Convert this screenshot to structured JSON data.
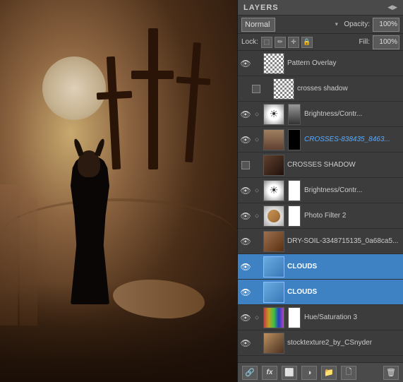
{
  "panel": {
    "title": "LAYERS",
    "collapse_label": "◀▶"
  },
  "blend": {
    "mode": "Normal",
    "opacity_label": "Opacity:",
    "opacity_value": "100%",
    "fill_label": "Fill:",
    "fill_value": "100%"
  },
  "lock": {
    "label": "Lock:"
  },
  "layers": [
    {
      "id": "pattern-overlay",
      "name": "Pattern Overlay",
      "visible": true,
      "selected": false,
      "has_eye": true,
      "has_link": false,
      "has_check": false,
      "thumb_type": "checker",
      "is_adjustment": false,
      "indent": false
    },
    {
      "id": "crosses-shadow-text",
      "name": "crosses shadow",
      "visible": false,
      "selected": false,
      "has_eye": false,
      "has_link": false,
      "has_check": true,
      "thumb_type": "checker",
      "is_adjustment": false,
      "indent": true
    },
    {
      "id": "brightness-contr-1",
      "name": "Brightness/Contr...",
      "visible": true,
      "selected": false,
      "has_eye": true,
      "has_link": true,
      "has_check": false,
      "thumb_type": "bright",
      "is_adjustment": true
    },
    {
      "id": "crosses-838435",
      "name": "CROSSES-838435_8463...",
      "visible": true,
      "selected": false,
      "has_eye": true,
      "has_link": true,
      "has_check": false,
      "thumb_type": "crosses",
      "is_adjustment": false
    },
    {
      "id": "crosses-shadow",
      "name": "CROSSES SHADOW",
      "visible": false,
      "selected": false,
      "has_eye": false,
      "has_link": false,
      "has_check": true,
      "thumb_type": "dark",
      "is_adjustment": false
    },
    {
      "id": "brightness-contr-2",
      "name": "Brightness/Contr...",
      "visible": true,
      "selected": false,
      "has_eye": true,
      "has_link": true,
      "has_check": false,
      "thumb_type": "bright",
      "is_adjustment": true
    },
    {
      "id": "photo-filter-2",
      "name": "Photo Filter 2",
      "visible": true,
      "selected": false,
      "has_eye": true,
      "has_link": true,
      "has_check": false,
      "thumb_type": "photo_filter",
      "is_adjustment": true
    },
    {
      "id": "dry-soil",
      "name": "DRY-SOIL-3348715135_0a68ca5...",
      "visible": true,
      "selected": false,
      "has_eye": true,
      "has_link": false,
      "has_check": false,
      "thumb_type": "soil",
      "is_adjustment": false
    },
    {
      "id": "clouds-1",
      "name": "CLOUDS",
      "visible": true,
      "selected": true,
      "has_eye": true,
      "has_link": false,
      "has_check": false,
      "thumb_type": "clouds",
      "is_adjustment": false
    },
    {
      "id": "clouds-2",
      "name": "CLOUDS",
      "visible": true,
      "selected": true,
      "has_eye": true,
      "has_link": false,
      "has_check": false,
      "thumb_type": "clouds",
      "is_adjustment": false
    },
    {
      "id": "hue-sat-3",
      "name": "Hue/Saturation 3",
      "visible": true,
      "selected": false,
      "has_eye": true,
      "has_link": true,
      "has_check": false,
      "thumb_type": "hue_sat",
      "is_adjustment": true
    },
    {
      "id": "stock-texture",
      "name": "stocktexture2_by_CSnyder",
      "visible": true,
      "selected": false,
      "has_eye": true,
      "has_link": false,
      "has_check": false,
      "thumb_type": "texture",
      "is_adjustment": false
    }
  ],
  "toolbar": {
    "link_icon": "🔗",
    "fx_icon": "fx",
    "mask_icon": "⬜",
    "adj_icon": "◑",
    "folder_icon": "📁",
    "trash_icon": "🗑"
  }
}
